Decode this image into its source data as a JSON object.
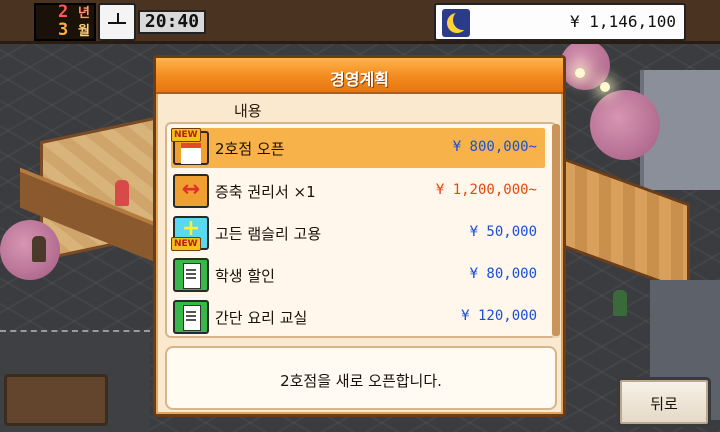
{
  "hud": {
    "year_num": "2",
    "year_unit": "년",
    "month_num": "3",
    "month_unit": "월",
    "time": "20:40",
    "money": "¥ 1,146,100",
    "time_of_day_icon": "moon-icon"
  },
  "dialog": {
    "title": "경영계획",
    "column_header": "내용",
    "items": [
      {
        "name": "2호점 오픈",
        "price": "¥ 800,000~",
        "icon": "store-icon",
        "new": true,
        "selected": true,
        "price_color": "#1a4fd6"
      },
      {
        "name": "증축 권리서 ×1",
        "price": "¥ 1,200,000~",
        "icon": "expand-icon",
        "new": false,
        "selected": false,
        "price_color": "#e24a12"
      },
      {
        "name": "고든 램슬리 고용",
        "price": "¥ 50,000",
        "icon": "hire-icon",
        "new": true,
        "selected": false,
        "price_color": "#1a4fd6"
      },
      {
        "name": "학생 할인",
        "price": "¥ 80,000",
        "icon": "doc-icon",
        "new": false,
        "selected": false,
        "price_color": "#1a4fd6"
      },
      {
        "name": "간단 요리 교실",
        "price": "¥ 120,000",
        "icon": "doc-icon",
        "new": false,
        "selected": false,
        "price_color": "#1a4fd6"
      }
    ],
    "new_badge": "NEW",
    "description": "2호점을 새로 오픈합니다."
  },
  "back_button": {
    "label": "뒤로"
  },
  "colors": {
    "accent_orange": "#f28a1e",
    "price_blue": "#1a4fd6",
    "price_orange": "#e24a12",
    "selected_row": "#f7b24a"
  }
}
